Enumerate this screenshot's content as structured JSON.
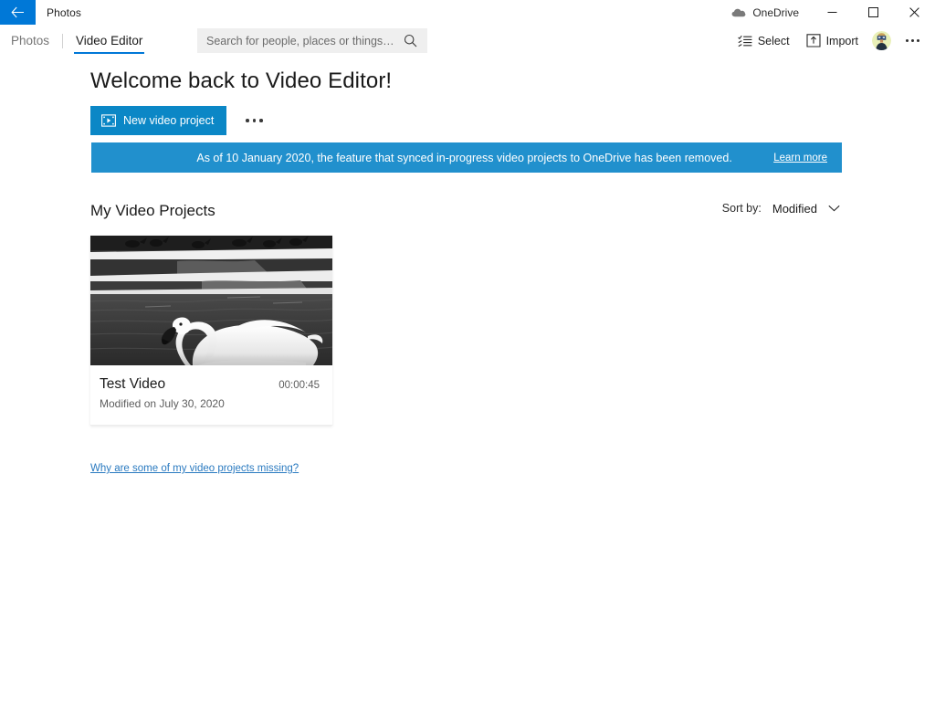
{
  "titlebar": {
    "back_label": "Back",
    "app_title": "Photos",
    "onedrive_label": "OneDrive",
    "minimize_label": "Minimize",
    "maximize_label": "Maximize",
    "close_label": "Close"
  },
  "navbar": {
    "tabs": [
      {
        "label": "Photos",
        "active": false
      },
      {
        "label": "Video Editor",
        "active": true
      }
    ],
    "search": {
      "placeholder": "Search for people, places or things…",
      "value": ""
    },
    "select_label": "Select",
    "import_label": "Import",
    "more_label": "See more"
  },
  "main": {
    "welcome_heading": "Welcome back to Video Editor!",
    "new_project_label": "New video project",
    "project_more_label": "See more",
    "banner": {
      "message": "As of 10 January 2020, the feature that synced in-progress video projects to OneDrive has been removed.",
      "link_label": "Learn more",
      "background_color": "#2190cd"
    },
    "section_title": "My Video Projects",
    "sort": {
      "label": "Sort by:",
      "value": "Modified"
    },
    "projects": [
      {
        "title": "Test Video",
        "duration": "00:00:45",
        "modified": "Modified on July 30, 2020",
        "thumbnail_alt": "Black and white photo of a swan swimming on water near a snowy bank with birds"
      }
    ],
    "missing_projects_link": "Why are some of my video projects missing?"
  },
  "colors": {
    "accent": "#0078d7",
    "button_blue": "#0b87c6",
    "banner_blue": "#2190cd",
    "link_blue": "#2a7ac0"
  }
}
